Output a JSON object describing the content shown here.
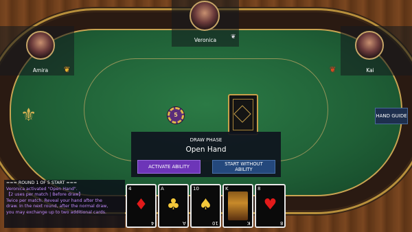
{
  "players": {
    "top": {
      "name": "Veronica"
    },
    "left": {
      "name": "Amira"
    },
    "right": {
      "name": "Kai"
    }
  },
  "icons": {
    "avatar_top": "portrait-icon",
    "avatar_left": "portrait-icon",
    "avatar_right": "portrait-icon",
    "sigil_top": "silver-crest-icon",
    "sigil_left": "gold-blue-crest-icon",
    "sigil_right": "gold-red-crest-icon",
    "table_ornament": "fleur-icon",
    "deck": "card-back-icon",
    "chip": "poker-chip-icon"
  },
  "chip": {
    "value": "5"
  },
  "buttons": {
    "hand_guide": "HAND GUIDE"
  },
  "phase": {
    "label": "DRAW PHASE",
    "name": "Open Hand",
    "activate_label": "ACTIVATE ABILITY",
    "skip_label": "START WITHOUT ABILITY"
  },
  "log": {
    "lines": [
      "=== ROUND 1 OF 5 START ===",
      "Veronica activated \"Open Hand\".",
      "【2 uses per match | Before draw】",
      "Twice per match. Reveal your hand after the",
      "draw. In the next round, after the normal draw,",
      "you may exchange up to two additional cards."
    ]
  },
  "hand": [
    {
      "rank": "4",
      "suit": "♦",
      "suit_name": "diamond-icon",
      "color": "#e21a1a"
    },
    {
      "rank": "A",
      "suit": "♣",
      "suit_name": "club-icon",
      "color": "#f4c83a"
    },
    {
      "rank": "10",
      "suit": "♠",
      "suit_name": "spade-icon",
      "color": "#f4c83a"
    },
    {
      "rank": "K",
      "suit": "♦",
      "suit_name": "king-portrait-icon",
      "color": "#e21a1a"
    },
    {
      "rank": "8",
      "suit": "♥",
      "suit_name": "heart-icon",
      "color": "#e21a1a"
    }
  ],
  "colors": {
    "felt": "#1f5f36",
    "rail_gold": "#c9a452",
    "activate_button": "#6d35b8",
    "skip_button": "#24487c",
    "log_ability_text": "#c38cff",
    "red_suit": "#e21a1a",
    "gold_suit": "#f4c83a"
  }
}
